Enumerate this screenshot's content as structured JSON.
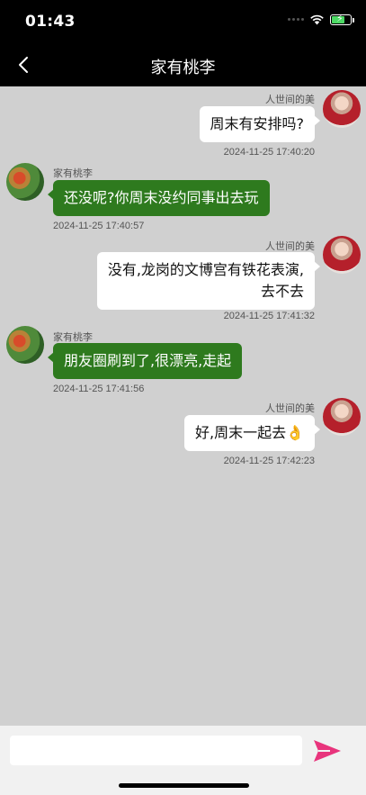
{
  "status": {
    "time": "01:43"
  },
  "nav": {
    "title": "家有桃李"
  },
  "messages": [
    {
      "sender": "人世间的美",
      "text": "周末有安排吗?",
      "time": "2024-11-25 17:40:20"
    },
    {
      "sender": "家有桃李",
      "text": "还没呢?你周末没约同事出去玩",
      "time": "2024-11-25 17:40:57"
    },
    {
      "sender": "人世间的美",
      "line1": "没有,龙岗的文博宫有铁花表演,",
      "line2": "去不去",
      "time": "2024-11-25 17:41:32"
    },
    {
      "sender": "家有桃李",
      "text": "朋友圈刷到了,很漂亮,走起",
      "time": "2024-11-25 17:41:56"
    },
    {
      "sender": "人世间的美",
      "text": "好,周末一起去👌",
      "time": "2024-11-25 17:42:23"
    }
  ],
  "input": {
    "value": "",
    "placeholder": ""
  },
  "colors": {
    "me_bubble": "#ffffff",
    "other_bubble": "#2e7a1e",
    "chat_bg": "#d0d0d0",
    "send": "#e8347c"
  },
  "icons": {
    "back": "chevron-left-icon",
    "send": "send-arrow-icon",
    "wifi": "wifi-icon",
    "battery": "battery-charging-icon"
  }
}
